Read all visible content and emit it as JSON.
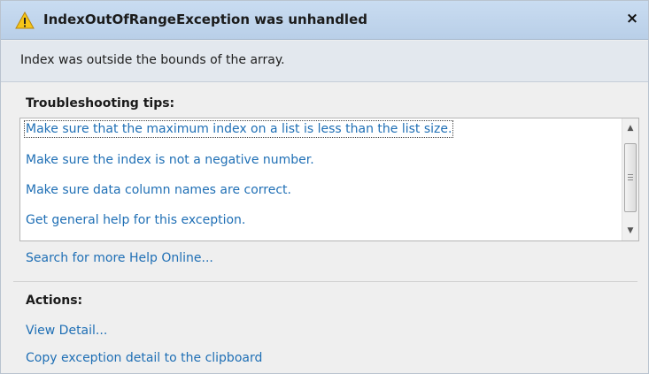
{
  "dialog": {
    "title": "IndexOutOfRangeException was unhandled",
    "message": "Index was outside the bounds of the array.",
    "close_icon": "×"
  },
  "troubleshooting": {
    "header": "Troubleshooting tips:",
    "tips": [
      "Make sure that the maximum index on a list is less than the list size.",
      "Make sure the index is not a negative number.",
      "Make sure data column names are correct.",
      "Get general help for this exception."
    ],
    "search_link": "Search for more Help Online..."
  },
  "actions": {
    "header": "Actions:",
    "items": [
      "View Detail...",
      "Copy exception detail to the clipboard"
    ]
  },
  "icons": {
    "warning": "warning-icon",
    "close": "close-icon",
    "scroll_up": "scroll-up-arrow-icon",
    "scroll_down": "scroll-down-arrow-icon"
  },
  "colors": {
    "title_bar": "#c3d8ef",
    "link": "#1f6fb5",
    "warning_fill": "#f5c518"
  },
  "scrollbar": {
    "up_arrow": "▲",
    "down_arrow": "▼"
  }
}
